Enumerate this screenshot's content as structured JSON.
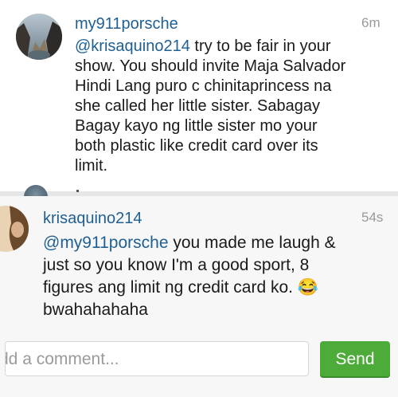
{
  "comments": [
    {
      "username": "my911porsche",
      "time": "6m",
      "mention": "@krisaquino214",
      "text": " try to be fair in your\nshow. You should invite Maja Salvador\nHindi Lang puro c chinitaprincess na\nshe called her little sister. Sabagay\nBagay kayo ng little sister mo your\nboth plastic like credit card over its\nlimit."
    },
    {
      "username": "krisaquino214",
      "time": "54s",
      "mention": "@my911porsche",
      "text": " you made me laugh &\njust so you know I'm a good sport, 8\nfigures ang limit ng credit card ko. 😂\nbwahahahaha"
    }
  ],
  "composer": {
    "placeholder_visible": "dd a comment...",
    "send_label": "Send"
  },
  "colors": {
    "username": "#1f5f92",
    "send_button": "#4dab3a"
  }
}
